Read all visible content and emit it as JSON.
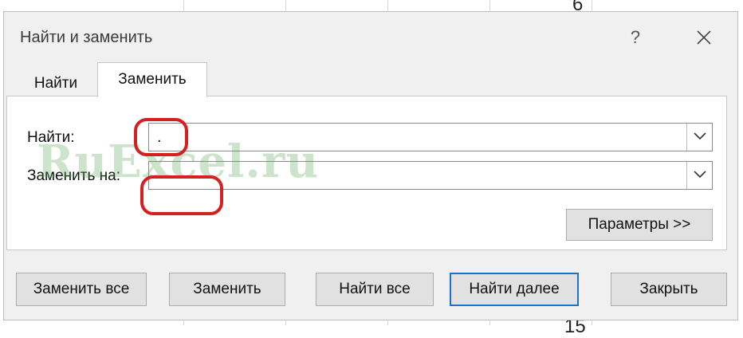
{
  "background": {
    "cell_top": "6",
    "cell_bottom": "15"
  },
  "dialog": {
    "title": "Найти и заменить",
    "help": "?",
    "tabs": [
      {
        "label": "Найти",
        "active": false
      },
      {
        "label": "Заменить",
        "active": true
      }
    ],
    "find_label": "Найти:",
    "find_value": ".",
    "replace_label": "Заменить на:",
    "replace_value": "",
    "options_button": "Параметры >>",
    "buttons": {
      "replace_all": "Заменить все",
      "replace": "Заменить",
      "find_all": "Найти все",
      "find_next": "Найти далее",
      "close": "Закрыть"
    }
  },
  "watermark": "RuExcel.ru",
  "colors": {
    "accent": "#1b73c9",
    "annotation": "#d32121",
    "watermark": "#5caa5c"
  }
}
